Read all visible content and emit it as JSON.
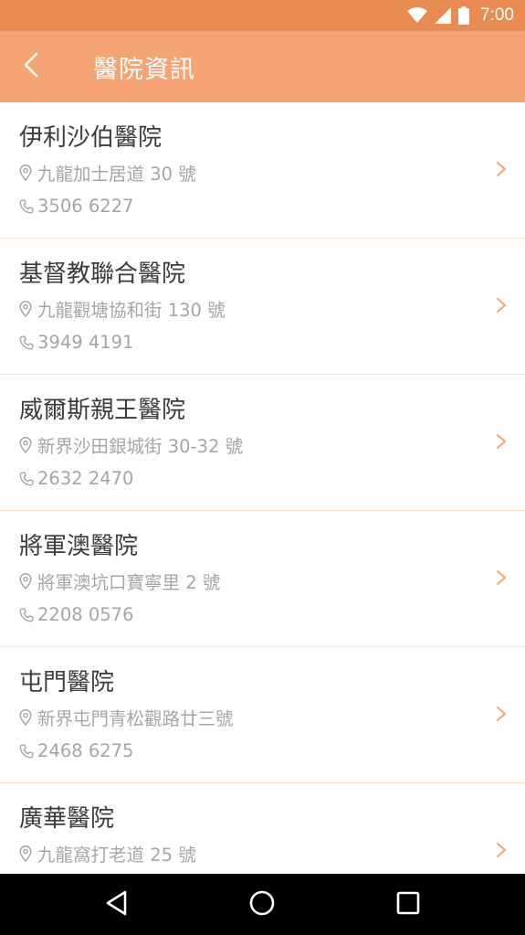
{
  "status_bar": {
    "time": "7:00",
    "icons": [
      "wifi-icon",
      "signal-icon",
      "battery-icon"
    ],
    "color": "#e98c52"
  },
  "app_bar": {
    "back_icon": "back-arrow-icon",
    "title": "醫院資訊",
    "color": "#f5a474"
  },
  "hospitals": [
    {
      "name": "伊利沙伯醫院",
      "address": "九龍加士居道 30 號",
      "phone": "3506 6227"
    },
    {
      "name": "基督教聯合醫院",
      "address": "九龍觀塘協和街 130 號",
      "phone": "3949 4191"
    },
    {
      "name": "威爾斯親王醫院",
      "address": "新界沙田銀城街 30-32 號",
      "phone": "2632 2470"
    },
    {
      "name": "將軍澳醫院",
      "address": "將軍澳坑口寶寧里 2 號",
      "phone": "2208 0576"
    },
    {
      "name": "屯門醫院",
      "address": "新界屯門青松觀路廿三號",
      "phone": "2468 6275"
    },
    {
      "name": "廣華醫院",
      "address": "九龍窩打老道 25 號"
    }
  ],
  "accent_color": "#f5a474",
  "nav_bar": {
    "buttons": [
      "back-triangle-icon",
      "home-circle-icon",
      "recents-square-icon"
    ]
  }
}
